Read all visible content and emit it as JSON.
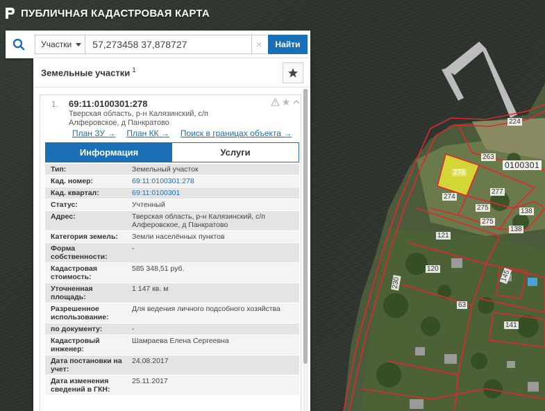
{
  "app": {
    "title": "ПУБЛИЧНАЯ КАДАСТРОВАЯ КАРТА",
    "logo_icon": "rosreestr-logo-icon"
  },
  "search": {
    "type_select": "Участки",
    "query": "57,273458 37,878727",
    "clear_label": "×",
    "button_label": "Найти",
    "search_icon": "search-icon"
  },
  "panel": {
    "title": "Земельные участки",
    "count": "1",
    "favorites_icon": "star-icon"
  },
  "result": {
    "number": "1.",
    "cad_number": "69:11:0100301:278",
    "address_line1": "Тверская область, р-н Калязинский, с/п",
    "address_line2": "Алферовское, д Панкратово",
    "links": {
      "plan_zu": "План ЗУ →",
      "plan_kk": "План КК →",
      "search_bounds": "Поиск в границах объекта →"
    },
    "tabs": {
      "info": "Информация",
      "services": "Услуги"
    },
    "details": [
      {
        "label": "Тип:",
        "value": "Земельный участок",
        "link": false
      },
      {
        "label": "Кад. номер:",
        "value": "69:11:0100301:278",
        "link": true
      },
      {
        "label": "Кад. квартал:",
        "value": "69:11:0100301",
        "link": true
      },
      {
        "label": "Статус:",
        "value": "Учтенный",
        "link": false
      },
      {
        "label": "Адрес:",
        "value": "Тверская область, р-н Калязинский, с/п Алферовское, д Панкратово",
        "link": false
      },
      {
        "label": "Категория земель:",
        "value": "Земли населённых пунктов",
        "link": false
      },
      {
        "label": "Форма собственности:",
        "value": "-",
        "link": false
      },
      {
        "label": "Кадастровая стоимость:",
        "value": "585 348,51 руб.",
        "link": false
      },
      {
        "label": "Уточненная площадь:",
        "value": "1 147 кв. м",
        "link": false
      },
      {
        "label": "Разрешенное использование:",
        "value": "Для ведения личного подсобного хозяйства",
        "link": false
      },
      {
        "label": "по документу:",
        "value": "-",
        "link": false
      },
      {
        "label": "Кадастровый инженер:",
        "value": "Шамраева Елена Сергеевна",
        "link": false
      },
      {
        "label": "Дата постановки на учет:",
        "value": "24.08.2017",
        "link": false
      },
      {
        "label": "Дата изменения сведений в ГКН:",
        "value": "25.11.2017",
        "link": false
      }
    ]
  },
  "map": {
    "quarter": "0100301",
    "parcels": [
      "224",
      "263",
      "278",
      "277",
      "274",
      "275",
      "138",
      "275",
      "138",
      "121",
      "120",
      "230",
      "63",
      "145",
      "141"
    ]
  },
  "colors": {
    "accent": "#1b6fb5",
    "parcel_border": "#e0282e",
    "selected_parcel": "#e6e633"
  }
}
